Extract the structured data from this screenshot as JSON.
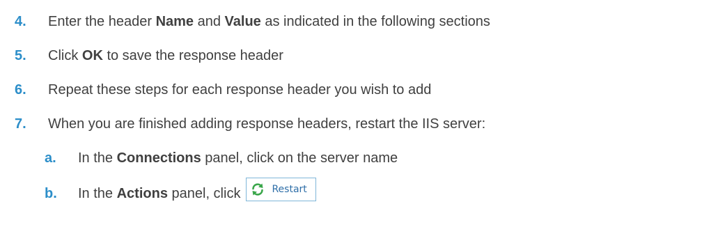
{
  "steps": [
    {
      "number": "4.",
      "parts": [
        "Enter the header ",
        "Name",
        " and ",
        "Value",
        " as indicated in the following sections"
      ]
    },
    {
      "number": "5.",
      "parts": [
        "Click ",
        "OK",
        " to save the response header"
      ]
    },
    {
      "number": "6.",
      "parts": [
        "Repeat these steps for each response header you wish to add"
      ]
    },
    {
      "number": "7.",
      "parts": [
        "When you are finished adding response headers, restart the IIS server:"
      ]
    }
  ],
  "substeps": [
    {
      "letter": "a.",
      "parts": [
        "In the ",
        "Connections",
        " panel, click on the server name"
      ]
    },
    {
      "letter": "b.",
      "parts": [
        "In the ",
        "Actions",
        " panel, click"
      ],
      "button_label": "Restart",
      "button_icon": "refresh-icon"
    }
  ],
  "colors": {
    "number": "#2c8ec9",
    "text": "#404040",
    "button_border": "#7fb6d9",
    "button_label": "#2f6fa8",
    "icon_green": "#3aa64a"
  }
}
